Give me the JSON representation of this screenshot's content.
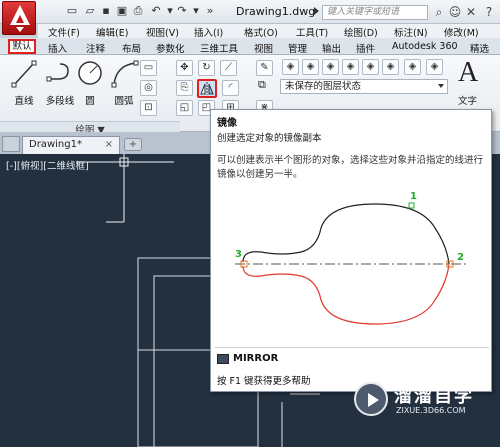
{
  "app": {
    "document_title": "Drawing1.dwg",
    "search_placeholder": "键入关键字或短语"
  },
  "menu": [
    "文件(F)",
    "编辑(E)",
    "视图(V)",
    "插入(I)",
    "格式(O)",
    "工具(T)",
    "绘图(D)",
    "标注(N)",
    "修改(M)"
  ],
  "ribbon_tabs": [
    "默认",
    "插入",
    "注释",
    "布局",
    "参数化",
    "三维工具",
    "视图",
    "管理",
    "输出",
    "插件",
    "Autodesk 360",
    "精选"
  ],
  "draw_panel": {
    "tools": [
      "直线",
      "多段线",
      "圆",
      "圆弧"
    ],
    "panel_label": "绘图 ▼"
  },
  "layers": {
    "state": "未保存的图层状态"
  },
  "annotation": {
    "text_tool": "文字",
    "text_glyph": "A"
  },
  "drawing_tab": {
    "name": "Drawing1*",
    "close": "×",
    "new": "+"
  },
  "viewport_label": "[-][俯视][二维线框]",
  "tooltip": {
    "title": "镜像",
    "description": "创建选定对象的镜像副本",
    "detail": "可以创建表示半个图形的对象，选择这些对象并沿指定的线进行镜像以创建另一半。",
    "points": [
      "1",
      "2",
      "3"
    ],
    "command": "MIRROR",
    "help": "按 F1 键获得更多帮助"
  },
  "watermark": {
    "name": "溜溜自学",
    "url": "ZIXUE.3D66.COM"
  },
  "colors": {
    "highlight": "#e01f1f",
    "canvas": "#233040",
    "point_green": "#1fae2b",
    "point_orange": "#e07a1f",
    "mirror_curve": "#e0392b"
  }
}
